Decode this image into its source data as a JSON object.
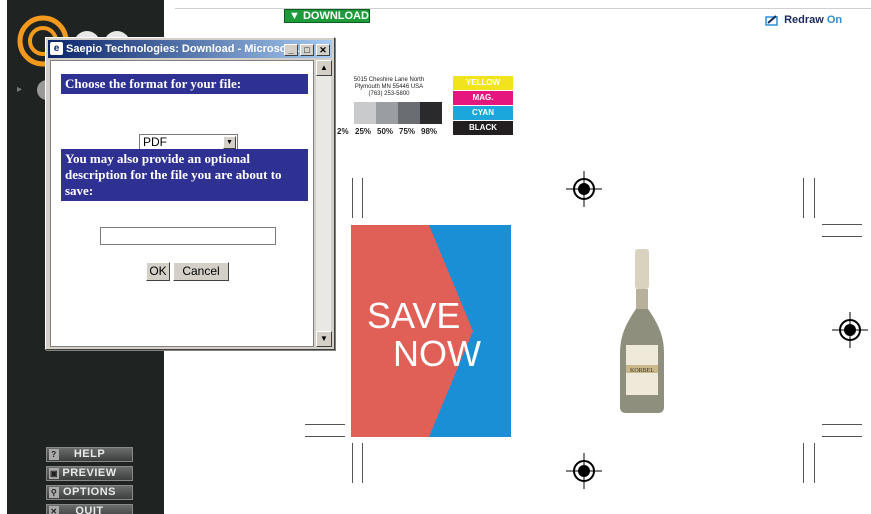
{
  "toolbar": {
    "download_label": "DOWNLOAD",
    "redraw_label": "Redraw",
    "redraw_state": "On"
  },
  "sidebar": {
    "buttons": [
      {
        "label": "HELP",
        "icon": "question-icon"
      },
      {
        "label": "PREVIEW",
        "icon": "preview-icon"
      },
      {
        "label": "OPTIONS",
        "icon": "magnifier-icon"
      },
      {
        "label": "QUIT",
        "icon": "x-icon"
      }
    ]
  },
  "proof": {
    "address_lines": [
      "5015 Cheshire Lane North",
      "Plymouth MN 55446 USA",
      "(763) 253-5800"
    ],
    "gray_labels": [
      "2%",
      "25%",
      "50%",
      "75%",
      "98%"
    ],
    "cmyk_labels": [
      "YELLOW",
      "MAG.",
      "CYAN",
      "BLACK"
    ],
    "ad_line1": "SAVE",
    "ad_line2": "NOW",
    "bottle_label": "KORBEL"
  },
  "dialog": {
    "title": "Saepio Technologies: Download - Microsoft ...",
    "format_heading": "Choose the format for your file:",
    "format_value": "PDF",
    "description_heading": "You may also provide an optional description for the file you are about to save:",
    "description_value": "",
    "ok_label": "OK",
    "cancel_label": "Cancel"
  },
  "colors": {
    "sidebar_bg": "#1f2423",
    "dialog_heading_bg": "#2e3192",
    "ad_red": "#e05f57",
    "ad_blue": "#1a8fd6",
    "download_green": "#1d9a3a"
  }
}
